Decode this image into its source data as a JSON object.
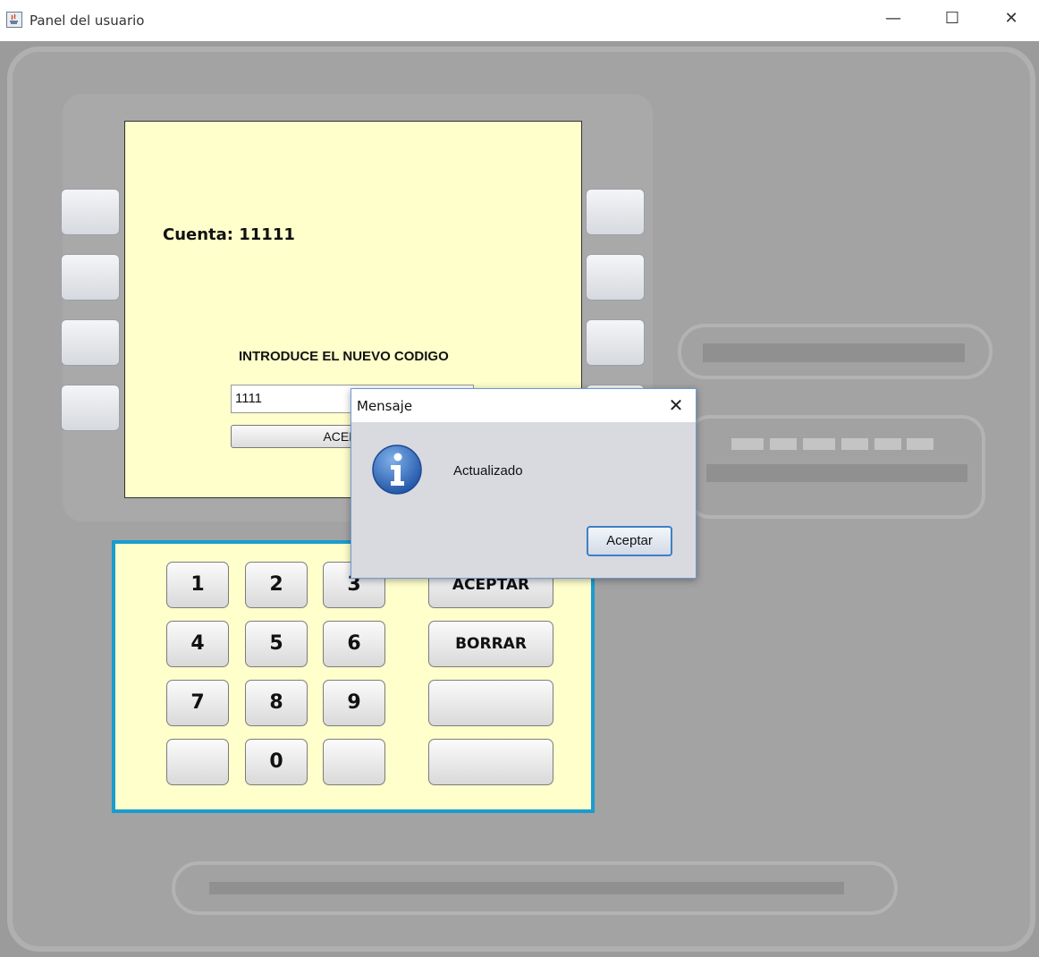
{
  "window": {
    "title": "Panel del usuario",
    "icons": {
      "app": "java-icon",
      "minimize": "minimize-icon",
      "maximize": "maximize-icon",
      "close": "close-icon"
    }
  },
  "screen": {
    "account_label": "Cuenta: 11111",
    "prompt": "INTRODUCE EL NUEVO CODIGO",
    "code_value": "1111",
    "accept_button": "ACEPTAR"
  },
  "keypad": {
    "digits": [
      "1",
      "2",
      "3",
      "4",
      "5",
      "6",
      "7",
      "8",
      "9",
      "",
      "0",
      ""
    ],
    "actions": [
      "ACEPTAR",
      "BORRAR",
      "",
      ""
    ]
  },
  "dialog": {
    "title": "Mensaje",
    "message": "Actualizado",
    "ok_button": "Aceptar",
    "icon": "info-icon"
  },
  "colors": {
    "screen_bg": "#ffffcc",
    "keypad_border": "#1a9ccf",
    "machine_body": "#9b9b9b"
  }
}
